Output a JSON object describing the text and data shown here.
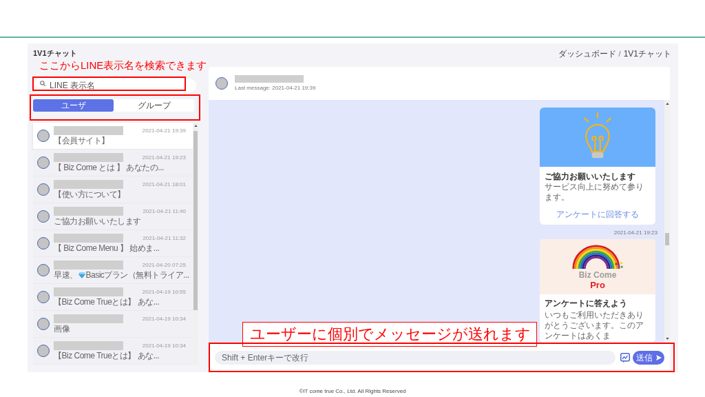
{
  "slide": {
    "footer": "©IT come true Co., Ltd. All Rights Reserved"
  },
  "page": {
    "title": "1V1チャット",
    "breadcrumb": [
      {
        "label": "ダッシュボード"
      },
      {
        "label": "1V1チャット"
      }
    ],
    "breadcrumb_separator": "/"
  },
  "search": {
    "placeholder": "LINE 表示名"
  },
  "tabs": [
    {
      "label": "ユーザ",
      "selected": true
    },
    {
      "label": "グループ",
      "selected": false
    }
  ],
  "conversations": [
    {
      "kind": "text",
      "time": "2021-04-21 19:39",
      "preview": "【会員サイト】",
      "selected": true
    },
    {
      "kind": "text",
      "time": "2021-04-21 19:23",
      "preview": "【 Biz Come とは 】 あなたの...",
      "selected": false
    },
    {
      "kind": "text",
      "time": "2021-04-21 18:01",
      "preview": "【使い方について】",
      "selected": false
    },
    {
      "kind": "text",
      "time": "2021-04-21 11:40",
      "preview": "ご協力お願いいたします",
      "selected": false
    },
    {
      "kind": "text",
      "time": "2021-04-21 11:32",
      "preview": "【 Biz Come Menu 】 始めま...",
      "selected": false
    },
    {
      "kind": "gem_text",
      "time": "2021-04-20 07:25",
      "preview": "早速、",
      "preview_rest": "Basicプラン（無料トライア...",
      "selected": false
    },
    {
      "kind": "text",
      "time": "2021-04-19 10:55",
      "preview": "【Biz Come Trueとは】 あな...",
      "selected": false
    },
    {
      "kind": "text",
      "time": "2021-04-19 10:34",
      "preview": "画像",
      "selected": false
    },
    {
      "kind": "text",
      "time": "2021-04-19 10:34",
      "preview": "【Biz Come Trueとは】 あな...",
      "selected": false
    }
  ],
  "chat": {
    "last_message": "Last message: 2021-04-21 19:39",
    "messages": [
      {
        "kind": "bulb_card",
        "title": "ご協力お願いいたします",
        "text": "サービス向上に努めて参ります。",
        "link": "アンケートに回答する"
      },
      {
        "kind": "logo_card",
        "time": "2021-04-21 19:23",
        "logo_lines": [
          "Biz Come",
          "Pro"
        ],
        "title": "アンケートに答えよう",
        "text": "いつもご利用いただきありがとうございます。このアンケートはあくま"
      }
    ]
  },
  "composer": {
    "placeholder": "Shift + Enterキーで改行",
    "send_label": "送信"
  },
  "annotations": [
    {
      "kind": "note",
      "text": "ここからLINE表示名を検索できます"
    },
    {
      "kind": "frame"
    },
    {
      "kind": "frame"
    },
    {
      "kind": "callout",
      "text": "ユーザーに個別でメッセージが送れます"
    },
    {
      "kind": "frame"
    }
  ]
}
